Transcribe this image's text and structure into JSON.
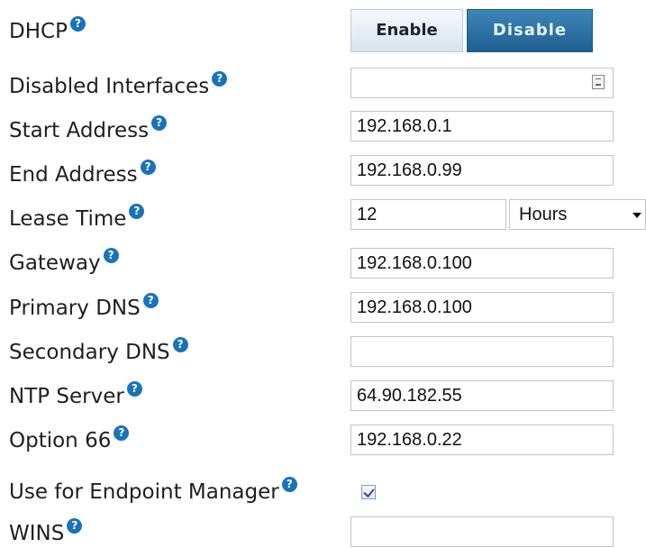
{
  "form": {
    "dhcp": {
      "label": "DHCP",
      "enable_label": "Enable",
      "disable_label": "Disable",
      "selected": "Disable"
    },
    "disabled_interfaces": {
      "label": "Disabled Interfaces",
      "value": ""
    },
    "start_address": {
      "label": "Start Address",
      "value": "192.168.0.1"
    },
    "end_address": {
      "label": "End Address",
      "value": "192.168.0.99"
    },
    "lease_time": {
      "label": "Lease Time",
      "value": "12",
      "unit": "Hours"
    },
    "gateway": {
      "label": "Gateway",
      "value": "192.168.0.100"
    },
    "primary_dns": {
      "label": "Primary DNS",
      "value": "192.168.0.100"
    },
    "secondary_dns": {
      "label": "Secondary DNS",
      "value": ""
    },
    "ntp_server": {
      "label": "NTP Server",
      "value": "64.90.182.55"
    },
    "option66": {
      "label": "Option 66",
      "value": "192.168.0.22"
    },
    "endpoint_manager": {
      "label": "Use for Endpoint Manager",
      "checked": true
    },
    "wins": {
      "label": "WINS",
      "value": ""
    }
  },
  "help_icon_glyph": "?",
  "colors": {
    "help_icon": "#1a73b8",
    "selected_button": "#2a6fa1"
  }
}
